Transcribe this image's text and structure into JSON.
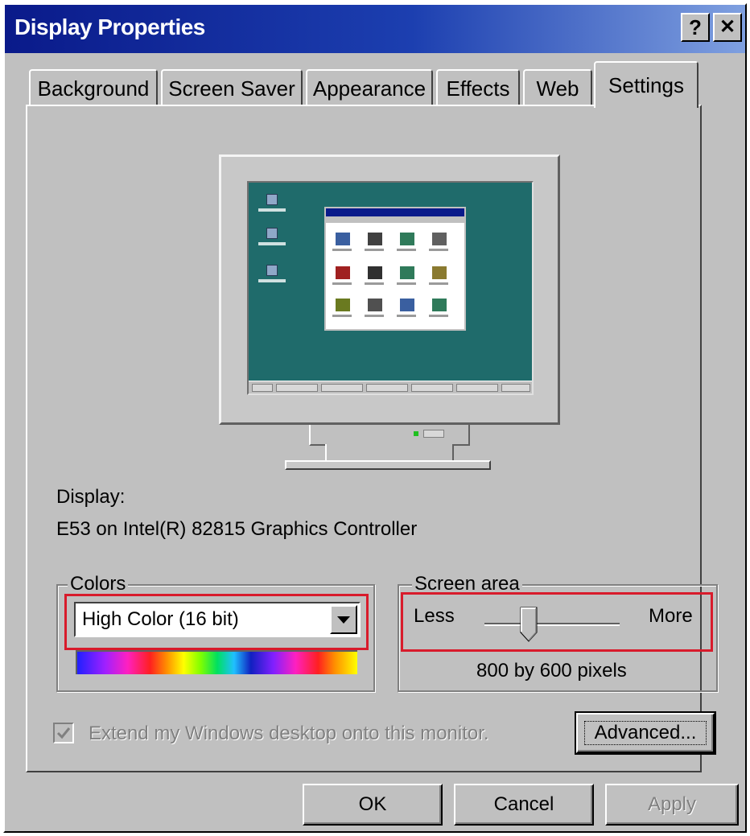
{
  "window": {
    "title": "Display Properties",
    "help_glyph": "?",
    "close_glyph": "✕",
    "titlebar_color": "#0a1a8a"
  },
  "tabs": [
    {
      "label": "Background"
    },
    {
      "label": "Screen Saver"
    },
    {
      "label": "Appearance"
    },
    {
      "label": "Effects"
    },
    {
      "label": "Web"
    },
    {
      "label": "Settings",
      "active": true
    }
  ],
  "settings": {
    "display_label": "Display:",
    "display_device": "E53 on Intel(R) 82815 Graphics Controller",
    "colors": {
      "legend": "Colors",
      "selected": "High Color (16 bit)"
    },
    "screen_area": {
      "legend": "Screen area",
      "less_label": "Less",
      "more_label": "More",
      "resolution_text": "800 by 600 pixels",
      "slider_position_fraction": 0.33
    },
    "extend_desktop": {
      "label": "Extend my Windows desktop onto this monitor.",
      "checked": true,
      "enabled": false
    },
    "advanced_button": "Advanced...",
    "highlight_color": "#d81b2b"
  },
  "footer": {
    "ok": "OK",
    "cancel": "Cancel",
    "apply": "Apply"
  }
}
